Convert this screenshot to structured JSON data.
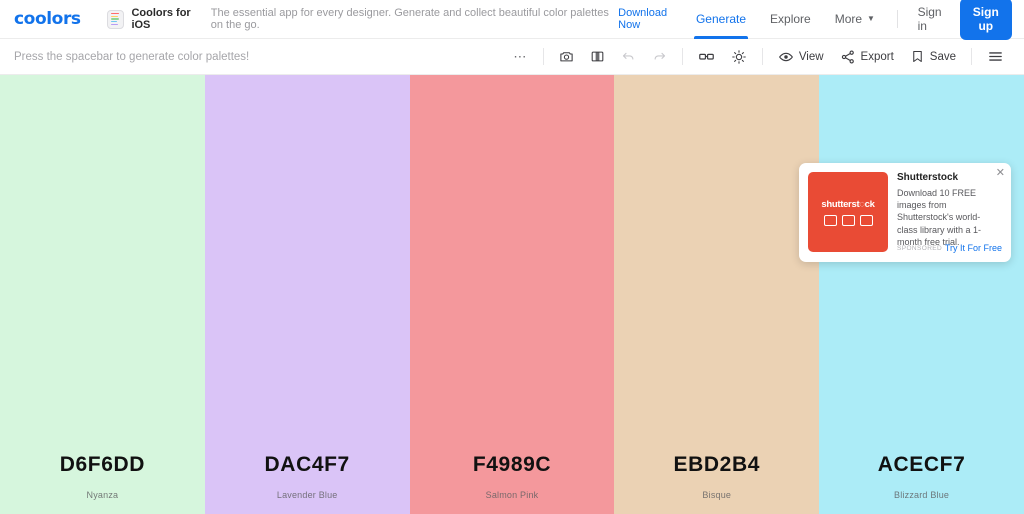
{
  "header": {
    "logo": "coolors",
    "promo": {
      "icon": "ios-app-icon",
      "title": "Coolors for iOS",
      "text": "The essential app for every designer. Generate and collect beautiful color palettes on the go.",
      "link": "Download Now"
    },
    "nav": [
      {
        "label": "Generate",
        "active": true
      },
      {
        "label": "Explore",
        "active": false
      },
      {
        "label": "More",
        "active": false,
        "chevron": "chevron-down-icon"
      }
    ],
    "signin_label": "Sign in",
    "signup_label": "Sign up",
    "accent_color": "#1273EB"
  },
  "toolbar": {
    "hint": "Press the spacebar to generate color palettes!",
    "more_icon": "ellipsis-icon",
    "tools": [
      {
        "icon": "camera-icon",
        "label": ""
      },
      {
        "icon": "contrast-panel-icon",
        "label": ""
      },
      {
        "icon": "undo-icon",
        "label": "",
        "disabled": true
      },
      {
        "icon": "redo-icon",
        "label": "",
        "disabled": true
      },
      {
        "icon": "glasses-icon",
        "label": ""
      },
      {
        "icon": "sun-icon",
        "label": ""
      },
      {
        "icon": "eye-icon",
        "label": "View"
      },
      {
        "icon": "share-nodes-icon",
        "label": "Export"
      },
      {
        "icon": "bookmark-icon",
        "label": "Save"
      },
      {
        "icon": "hamburger-menu-icon",
        "label": ""
      }
    ]
  },
  "palette": {
    "swatches": [
      {
        "hex": "D6F6DD",
        "color": "#D6F6DD",
        "name": "Nyanza"
      },
      {
        "hex": "DAC4F7",
        "color": "#DAC4F7",
        "name": "Lavender Blue"
      },
      {
        "hex": "F4989C",
        "color": "#F4989C",
        "name": "Salmon Pink"
      },
      {
        "hex": "EBD2B4",
        "color": "#EBD2B4",
        "name": "Bisque"
      },
      {
        "hex": "ACECF7",
        "color": "#ACECF7",
        "name": "Blizzard Blue"
      }
    ]
  },
  "ad": {
    "brand": "Shutterstock",
    "logo_text": "shutterst◌ck",
    "description": "Download 10 FREE images from Shutterstock's world-class library with a 1-month free trial.",
    "sponsored_label": "SPONSORED",
    "cta": "Try It For Free",
    "close_icon": "close-icon",
    "brand_color": "#e94b35"
  }
}
